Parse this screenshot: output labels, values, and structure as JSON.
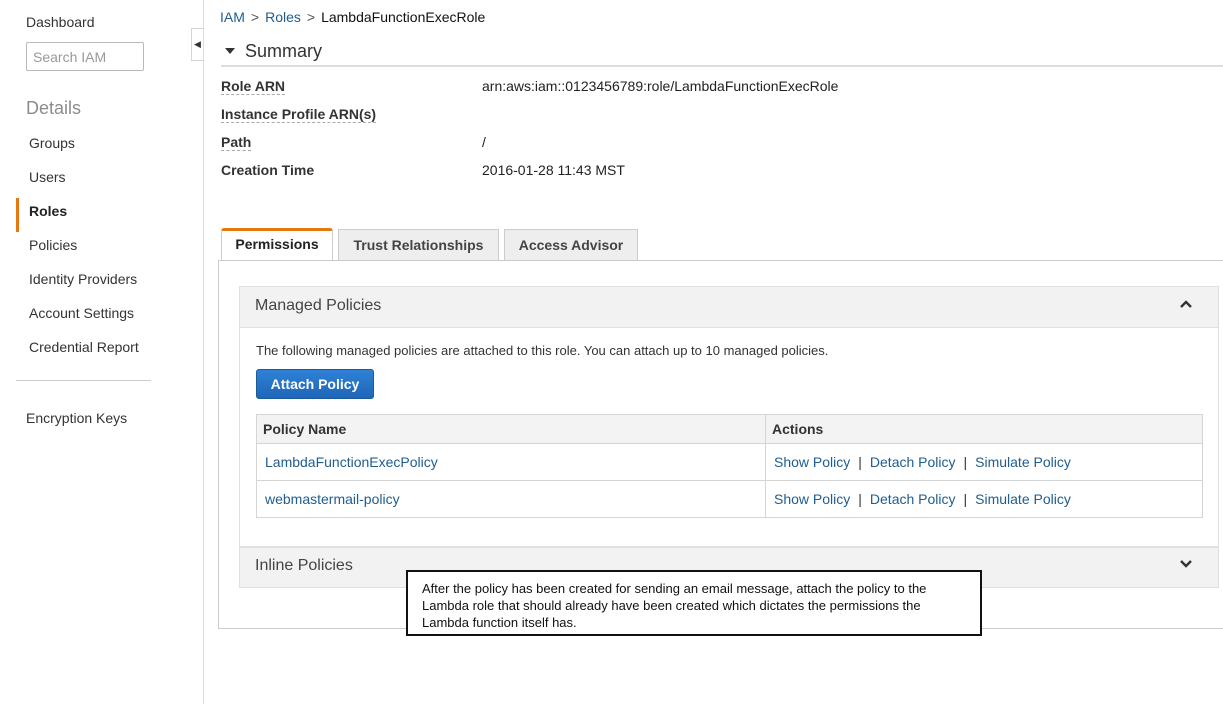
{
  "sidebar": {
    "dashboard": "Dashboard",
    "search_placeholder": "Search IAM",
    "details_heading": "Details",
    "items": [
      {
        "label": "Groups"
      },
      {
        "label": "Users"
      },
      {
        "label": "Roles"
      },
      {
        "label": "Policies"
      },
      {
        "label": "Identity Providers"
      },
      {
        "label": "Account Settings"
      },
      {
        "label": "Credential Report"
      }
    ],
    "active_item": "Roles",
    "encryption_keys": "Encryption Keys"
  },
  "breadcrumb": {
    "root": "IAM",
    "parent": "Roles",
    "current": "LambdaFunctionExecRole",
    "separator": ">"
  },
  "summary": {
    "title": "Summary",
    "fields": [
      {
        "key": "Role ARN",
        "value": "arn:aws:iam::0123456789:role/LambdaFunctionExecRole"
      },
      {
        "key": "Instance Profile ARN(s)",
        "value": ""
      },
      {
        "key": "Path",
        "value": "/"
      },
      {
        "key": "Creation Time",
        "value": "2016-01-28 11:43 MST"
      }
    ]
  },
  "tabs": [
    {
      "label": "Permissions",
      "active": true
    },
    {
      "label": "Trust Relationships",
      "active": false
    },
    {
      "label": "Access Advisor",
      "active": false
    }
  ],
  "managed_policies": {
    "title": "Managed Policies",
    "description": "The following managed policies are attached to this role. You can attach up to 10 managed policies.",
    "attach_button": "Attach Policy",
    "columns": [
      "Policy Name",
      "Actions"
    ],
    "rows": [
      {
        "name": "LambdaFunctionExecPolicy",
        "actions": [
          "Show Policy",
          "Detach Policy",
          "Simulate Policy"
        ]
      },
      {
        "name": "webmastermail-policy",
        "actions": [
          "Show Policy",
          "Detach Policy",
          "Simulate Policy"
        ]
      }
    ],
    "action_separator": "|"
  },
  "inline_policies": {
    "title": "Inline Policies"
  },
  "callout": {
    "text": "After the policy has been created for sending an email message, attach the policy to the Lambda role that should already have been created which dictates the permissions the Lambda function itself has."
  },
  "colors": {
    "accent_orange": "#e47911",
    "link_blue": "#1f5d8f",
    "button_blue": "#1f66b8"
  }
}
